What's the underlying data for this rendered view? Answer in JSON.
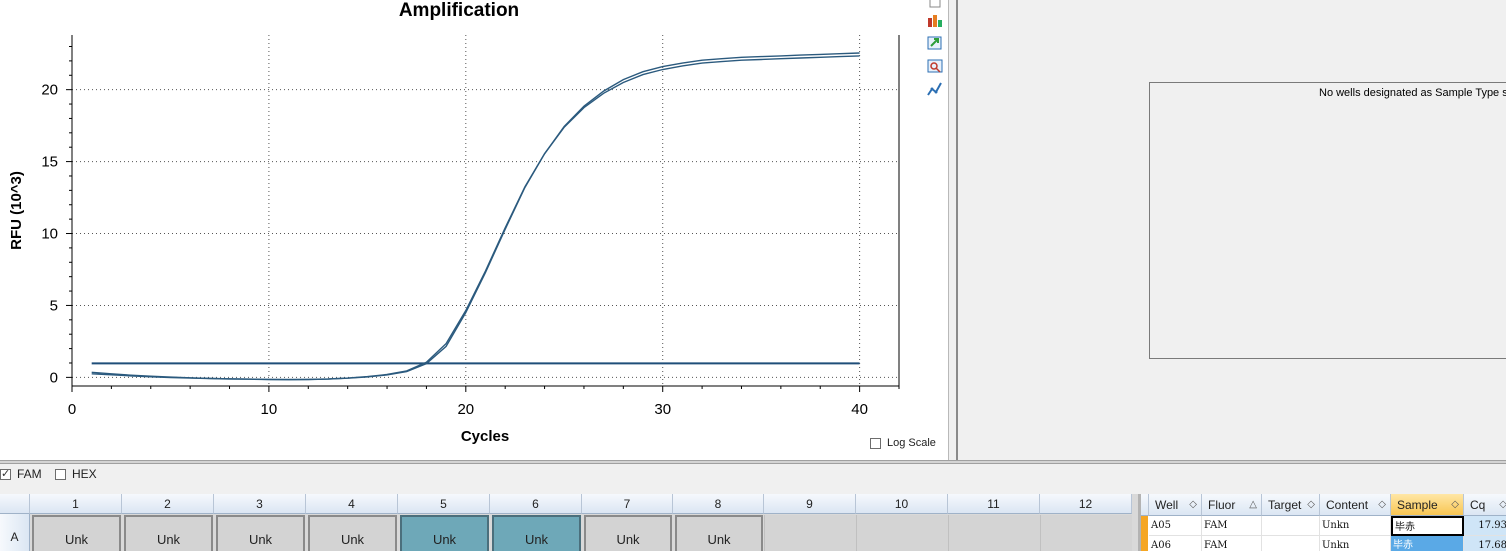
{
  "chart_data": {
    "type": "line",
    "title": "Amplification",
    "xlabel": "Cycles",
    "ylabel": "RFU (10^3)",
    "xlim": [
      0,
      42
    ],
    "ylim": [
      -0.6,
      23.8
    ],
    "xticks": [
      0,
      10,
      20,
      30,
      40
    ],
    "yticks": [
      0,
      5,
      10,
      15,
      20
    ],
    "grid": true,
    "threshold": 0.97,
    "series": [
      {
        "x": [
          1,
          2,
          3,
          4,
          5,
          6,
          7,
          8,
          9,
          10,
          11,
          12,
          13,
          14,
          15,
          16,
          17,
          18,
          19,
          20,
          21,
          22,
          23,
          24,
          25,
          26,
          27,
          28,
          29,
          30,
          31,
          32,
          33,
          34,
          35,
          36,
          37,
          38,
          39,
          40
        ],
        "values": [
          0.35,
          0.25,
          0.15,
          0.08,
          0.02,
          -0.03,
          -0.07,
          -0.1,
          -0.12,
          -0.14,
          -0.15,
          -0.14,
          -0.11,
          -0.05,
          0.05,
          0.2,
          0.45,
          1.05,
          2.35,
          4.65,
          7.4,
          10.4,
          13.25,
          15.55,
          17.4,
          18.75,
          19.75,
          20.5,
          21.05,
          21.4,
          21.65,
          21.85,
          21.95,
          22.05,
          22.1,
          22.15,
          22.2,
          22.25,
          22.3,
          22.35
        ],
        "color": "#2b5a7e"
      },
      {
        "x": [
          1,
          2,
          3,
          4,
          5,
          6,
          7,
          8,
          9,
          10,
          11,
          12,
          13,
          14,
          15,
          16,
          17,
          18,
          19,
          20,
          21,
          22,
          23,
          24,
          25,
          26,
          27,
          28,
          29,
          30,
          31,
          32,
          33,
          34,
          35,
          36,
          37,
          38,
          39,
          40
        ],
        "values": [
          0.25,
          0.18,
          0.1,
          0.04,
          -0.01,
          -0.05,
          -0.08,
          -0.11,
          -0.13,
          -0.15,
          -0.16,
          -0.15,
          -0.12,
          -0.06,
          0.03,
          0.17,
          0.4,
          0.95,
          2.15,
          4.5,
          7.3,
          10.3,
          13.2,
          15.55,
          17.45,
          18.85,
          19.9,
          20.7,
          21.25,
          21.6,
          21.85,
          22.05,
          22.15,
          22.25,
          22.3,
          22.35,
          22.4,
          22.45,
          22.5,
          22.55
        ],
        "color": "#2b5a7e"
      }
    ]
  },
  "toolbar_icons": [
    "copy-icon",
    "chart-bars-icon",
    "export-icon",
    "zoom-chart-icon",
    "curve-icon"
  ],
  "log_scale": {
    "label": "Log Scale",
    "checked": false
  },
  "fluors": [
    {
      "label": "FAM",
      "checked": true
    },
    {
      "label": "HEX",
      "checked": false
    }
  ],
  "standard_curve": {
    "message": "No wells designated as Sample Type st"
  },
  "plate": {
    "columns": [
      "1",
      "2",
      "3",
      "4",
      "5",
      "6",
      "7",
      "8",
      "9",
      "10",
      "11",
      "12"
    ],
    "row_label": "A",
    "wells": [
      "Unk",
      "Unk",
      "Unk",
      "Unk",
      "Unk",
      "Unk",
      "Unk",
      "Unk",
      "",
      "",
      "",
      ""
    ],
    "selected": [
      5,
      6
    ]
  },
  "table": {
    "headers": [
      "Well",
      "Fluor",
      "Target",
      "Content",
      "Sample",
      "Cq"
    ],
    "rows": [
      [
        "A05",
        "FAM",
        "",
        "Unkn",
        "毕赤",
        "17.93"
      ],
      [
        "A06",
        "FAM",
        "",
        "Unkn",
        "毕赤",
        "17.68"
      ]
    ]
  },
  "colors": {
    "curve": "#2b5a7e",
    "selected_well": "#6ea8b8",
    "sample_header": "#f8c552",
    "row_selector": "#f5a623"
  }
}
